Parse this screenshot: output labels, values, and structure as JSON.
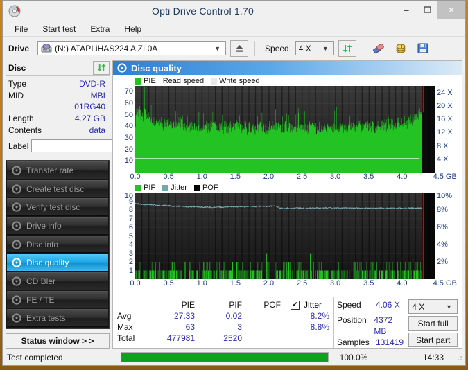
{
  "window": {
    "title": "Opti Drive Control 1.70",
    "icon": "disc-icon",
    "minimize": "–",
    "maximize": "❐",
    "close": "×"
  },
  "menu": {
    "items": [
      "File",
      "Start test",
      "Extra",
      "Help"
    ]
  },
  "toolbar": {
    "drive_label": "Drive",
    "drive_value": "(N:)   ATAPI iHAS224   A ZL0A",
    "eject_title": "Eject",
    "speed_label": "Speed",
    "speed_value": "4 X",
    "refresh_title": "Refresh",
    "erase_title": "Erase",
    "bitsetting_title": "Bitsetting",
    "save_title": "Save"
  },
  "disc": {
    "header": "Disc",
    "rows": [
      {
        "key": "Type",
        "value": "DVD-R"
      },
      {
        "key": "MID",
        "value": "MBI 01RG40"
      },
      {
        "key": "Length",
        "value": "4.27 GB"
      },
      {
        "key": "Contents",
        "value": "data"
      }
    ],
    "label_key": "Label",
    "label_value": "",
    "label_placeholder": ""
  },
  "nav": {
    "items": [
      {
        "label": "Transfer rate",
        "active": false
      },
      {
        "label": "Create test disc",
        "active": false
      },
      {
        "label": "Verify test disc",
        "active": false
      },
      {
        "label": "Drive info",
        "active": false
      },
      {
        "label": "Disc info",
        "active": false
      },
      {
        "label": "Disc quality",
        "active": true
      },
      {
        "label": "CD Bler",
        "active": false
      },
      {
        "label": "FE / TE",
        "active": false
      },
      {
        "label": "Extra tests",
        "active": false
      }
    ],
    "status_window": "Status window > >"
  },
  "panel": {
    "title": "Disc quality",
    "icon": "disc-quality-icon"
  },
  "stats": {
    "columns": [
      "PIE",
      "PIF",
      "POF",
      "Jitter"
    ],
    "jitter_checked": true,
    "jitter_check_glyph": "✔",
    "rows": [
      {
        "label": "Avg",
        "pie": "27.33",
        "pif": "0.02",
        "pof": "",
        "jitter": "8.2%"
      },
      {
        "label": "Max",
        "pie": "63",
        "pif": "3",
        "pof": "",
        "jitter": "8.8%"
      },
      {
        "label": "Total",
        "pie": "477981",
        "pif": "2520",
        "pof": "",
        "jitter": ""
      }
    ],
    "speed_key": "Speed",
    "speed_value": "4.06 X",
    "position_key": "Position",
    "position_value": "4372 MB",
    "samples_key": "Samples",
    "samples_value": "131419",
    "speed_select": "4 X",
    "start_full": "Start full",
    "start_part": "Start part"
  },
  "statusbar": {
    "text": "Test completed",
    "progress_percent": 100,
    "progress_label": "100.0%",
    "time": "14:33"
  },
  "chart_data": [
    {
      "type": "area",
      "name": "pie-chart",
      "title": "PIE / Read speed",
      "legend": [
        {
          "label": "PIE",
          "color": "#22c322"
        },
        {
          "label": "Read speed",
          "color": "#ffffff"
        },
        {
          "label": "Write speed",
          "color": "#e8e8e8"
        }
      ],
      "legend_position": "top-left",
      "xlabel": "GB",
      "x_ticks": [
        "0.0",
        "0.5",
        "1.0",
        "1.5",
        "2.0",
        "2.5",
        "3.0",
        "3.5",
        "4.0",
        "4.5"
      ],
      "xlim": [
        0,
        4.5
      ],
      "ylabel_left": "PIE",
      "y_ticks_left": [
        "70",
        "60",
        "50",
        "40",
        "30",
        "20",
        "10"
      ],
      "ylim_left": [
        0,
        75
      ],
      "ylabel_right": "Speed",
      "y_ticks_right": [
        "24 X",
        "20 X",
        "16 X",
        "12 X",
        "8 X",
        "4 X"
      ],
      "ylim_right": [
        0,
        26
      ],
      "grid": true,
      "data_end_gb": 4.3,
      "marker_color": "#ff0000",
      "series": [
        {
          "name": "PIE",
          "color": "#22c322",
          "kind": "bars",
          "avg": 27.33,
          "max": 63,
          "envelope": [
            43,
            58,
            52,
            61,
            50,
            55,
            47,
            63,
            52,
            48,
            50,
            45,
            47,
            44,
            46,
            43,
            45,
            42,
            44,
            46,
            43,
            41,
            44,
            42,
            45,
            43,
            41,
            43,
            40,
            42,
            41,
            43,
            40,
            42,
            44,
            41,
            40,
            43,
            41,
            39,
            42,
            40,
            42,
            41,
            39,
            41,
            43,
            40,
            42,
            39,
            41,
            44,
            40,
            42,
            39,
            41,
            40,
            43,
            41,
            39,
            41,
            40,
            42,
            40,
            38,
            41,
            39,
            42,
            40,
            38,
            40,
            43,
            39,
            41,
            38,
            40,
            42,
            39,
            41,
            38,
            40,
            39,
            42,
            40,
            38,
            41,
            39,
            41,
            44,
            40,
            38,
            41,
            39,
            42,
            40,
            38,
            40,
            39,
            41,
            38,
            40,
            43,
            39,
            41,
            38,
            40,
            42,
            39,
            41,
            38,
            40,
            39,
            42,
            40,
            38,
            41,
            39,
            41,
            40,
            38,
            41,
            39,
            42,
            40,
            38,
            40,
            43,
            39,
            41,
            38,
            40,
            42,
            39,
            41,
            44,
            40,
            39,
            42,
            40,
            38,
            41,
            39,
            42,
            40,
            38,
            40,
            43,
            39,
            41,
            38,
            40,
            42,
            39,
            41,
            38,
            40,
            39,
            42,
            40,
            38,
            41,
            39,
            41,
            44,
            40,
            38,
            41,
            40,
            42,
            40,
            38,
            41,
            43,
            40,
            42,
            39,
            41,
            40,
            43,
            41,
            39,
            42,
            41,
            43,
            40,
            42,
            41,
            44,
            42,
            40,
            43,
            42,
            44,
            43,
            41,
            44,
            43,
            45,
            44,
            42,
            45,
            44,
            46,
            45,
            43,
            46,
            48,
            45,
            47,
            50,
            48,
            52,
            51,
            49,
            52,
            51
          ]
        },
        {
          "name": "Read speed",
          "color": "#ffffff",
          "kind": "line",
          "value_x": 4.06,
          "points": [
            11.9,
            11.9,
            11.9,
            11.9,
            11.9,
            11.9,
            11.9,
            11.9,
            11.9,
            11.9,
            11.9,
            11.9,
            11.9,
            11.9,
            11.9,
            11.9,
            11.9,
            11.9,
            11.9,
            11.9,
            11.9,
            11.9,
            11.9,
            11.9,
            11.9,
            11.9,
            11.9,
            11.9,
            11.9,
            11.9,
            11.9,
            11.9,
            11.9,
            11.9,
            11.9,
            11.9,
            11.9,
            11.9,
            11.9,
            11.9
          ]
        }
      ]
    },
    {
      "type": "bar",
      "name": "pif-chart",
      "title": "PIF / Jitter / POF",
      "legend": [
        {
          "label": "PIF",
          "color": "#22c322"
        },
        {
          "label": "Jitter",
          "color": "#6fa8ad"
        },
        {
          "label": "POF",
          "color": "#000000"
        }
      ],
      "legend_position": "top-left",
      "xlabel": "GB",
      "x_ticks": [
        "0.0",
        "0.5",
        "1.0",
        "1.5",
        "2.0",
        "2.5",
        "3.0",
        "3.5",
        "4.0",
        "4.5"
      ],
      "xlim": [
        0,
        4.5
      ],
      "ylabel_left": "PIF",
      "y_ticks_left": [
        "10",
        "9",
        "8",
        "7",
        "6",
        "5",
        "4",
        "3",
        "2",
        "1"
      ],
      "ylim_left": [
        0,
        10
      ],
      "ylabel_right": "Jitter",
      "y_ticks_right": [
        "10%",
        "8%",
        "6%",
        "4%",
        "2%"
      ],
      "ylim_right": [
        0,
        10
      ],
      "grid": true,
      "data_end_gb": 4.3,
      "marker_color": "#ff0000",
      "series": [
        {
          "name": "PIF",
          "color": "#22c322",
          "kind": "bars",
          "avg": 0.02,
          "max": 3,
          "peaks": [
            {
              "x": 1.96,
              "y": 3
            },
            {
              "x": 2.62,
              "y": 3
            },
            {
              "x": 2.66,
              "y": 3
            }
          ],
          "typical_low": 1,
          "typical_high": 2
        },
        {
          "name": "Jitter",
          "color": "#7fb4ba",
          "kind": "line",
          "avg_percent": 8.2,
          "max_percent": 8.8,
          "points": [
            8.75,
            8.7,
            8.65,
            8.6,
            8.62,
            8.58,
            8.55,
            8.5,
            8.52,
            8.48,
            8.45,
            8.4,
            8.42,
            8.38,
            8.35,
            8.33,
            8.4,
            8.35,
            8.3,
            8.32,
            8.35,
            8.3,
            8.33,
            8.36,
            8.3,
            8.34,
            8.38,
            8.33,
            8.36,
            8.4,
            8.35,
            8.38,
            8.42,
            8.38,
            8.4,
            8.45,
            8.4,
            8.42,
            8.46,
            8.42,
            8.2,
            8.18,
            8.22,
            8.18,
            8.2,
            8.24,
            8.2,
            8.18,
            8.22,
            8.2,
            8.24,
            8.2,
            8.22,
            8.26,
            8.22,
            8.2,
            8.24,
            8.2,
            8.22,
            8.24,
            8.2,
            8.22,
            8.2,
            8.18,
            8.22,
            8.2,
            8.18,
            8.2,
            8.22,
            8.18,
            8.2,
            8.22,
            8.18,
            8.2,
            8.18,
            8.2,
            8.22,
            8.18,
            8.2,
            8.18
          ]
        }
      ]
    }
  ]
}
